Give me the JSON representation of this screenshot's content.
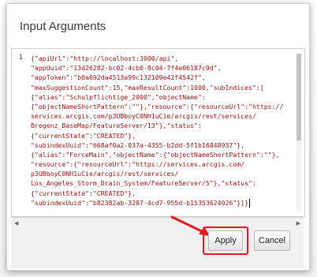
{
  "dialog": {
    "title": "Input Arguments",
    "apply_label": "Apply",
    "cancel_label": "Cancel"
  },
  "editor": {
    "line_number": "1",
    "lines": [
      "{\"apiUrl\":\"http://localhost:3000/api\",",
      "\"appUuid\":\"13d26282-bc02-4cb0-8c04-7f4e06187c9d\",",
      "\"appToken\":\"b0a692da4513a99c132109e42f4542f\",",
      "\"maxSuggestionCount\":15,\"maxResultCount\":1000,\"subIndices\":[",
      "{\"alias\":\"Schulpflichtige_2000\",\"objectName\":",
      "{\"objectNameShortPattern\":\"\"},\"resource\":{\"resourceUrl\":\"https://",
      "services.arcgis.com/p3UBboyC0NH1uCie/arcgis/rest/services/",
      "Bregenz_BaseMap/FeatureServer/13\"},\"status\":",
      "{\"currentState\":\"CREATED\"},",
      "\"subindexUuid\":\"668af0a2-037a-4355-b2dd-5f1b16848937\"},",
      "{\"alias\":\"ForceMain\",\"objectName\":{\"objectNameShortPattern\":\"\"},",
      "\"resource\":{\"resourceUrl\":\"https://services.arcgis.com/",
      "p3UBboyC0NH1uCie/arcgis/rest/services/",
      "Los_Angeles_Storm_Drain_System/FeatureServer/5\"},\"status\":",
      "{\"currentState\":\"CREATED\"},",
      "\"subindexUuid\":\"b82382ab-3287-4cd7-955d-b15353624026\"}]}"
    ]
  },
  "colors": {
    "highlight_box": "#e21b1b",
    "arrow": "#e21b1b",
    "code_text": "#a31515"
  }
}
